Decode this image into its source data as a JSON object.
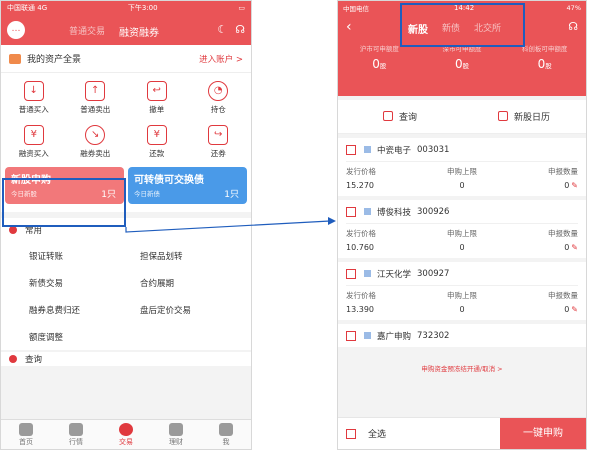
{
  "left": {
    "status": {
      "carrier": "中国联通",
      "network": "4G",
      "time": "下午3:00"
    },
    "nav": {
      "tabs": [
        "普通交易",
        "融资融券"
      ]
    },
    "asset": {
      "title": "我的资产全景",
      "enter": "进入账户 >"
    },
    "grid": [
      {
        "label": "普通买入",
        "icon": "cart-in-icon"
      },
      {
        "label": "普通卖出",
        "icon": "cart-out-icon"
      },
      {
        "label": "撤单",
        "icon": "cancel-order-icon"
      },
      {
        "label": "持仓",
        "icon": "pie-icon"
      },
      {
        "label": "融资买入",
        "icon": "margin-buy-icon"
      },
      {
        "label": "融券卖出",
        "icon": "short-sell-icon"
      },
      {
        "label": "还款",
        "icon": "repay-icon"
      },
      {
        "label": "还券",
        "icon": "return-stock-icon"
      }
    ],
    "cards": [
      {
        "title": "新股申购",
        "sub": "今日新股",
        "count": "1只",
        "color": "#f2787a"
      },
      {
        "title": "可转债可交换债",
        "sub": "今日新债",
        "count": "1只",
        "color": "#4a9ae8"
      }
    ],
    "common": {
      "title": "常用",
      "items": [
        "银证转账",
        "担保品划转",
        "新债交易",
        "合约展期",
        "融券息费归还",
        "盘后定价交易",
        "额度调整"
      ]
    },
    "query": "查询",
    "tabbar": [
      "首页",
      "行情",
      "交易",
      "理财",
      "我"
    ]
  },
  "right": {
    "status": {
      "carrier": "中国电信",
      "time": "14:42",
      "battery": "47%"
    },
    "nav": {
      "tabs": [
        "新股",
        "新债",
        "北交所"
      ]
    },
    "quota": [
      {
        "label": "沪市可申额度",
        "value": "0",
        "unit": "股"
      },
      {
        "label": "深市可申额度",
        "value": "0",
        "unit": "股"
      },
      {
        "label": "科创板可申额度",
        "value": "0",
        "unit": "股"
      }
    ],
    "actions": [
      "查询",
      "新股日历"
    ],
    "headers": [
      "发行价格",
      "申购上限",
      "申报数量"
    ],
    "stocks": [
      {
        "name": "中瓷电子",
        "code": "003031",
        "price": "15.270",
        "limit": "0",
        "qty": "0"
      },
      {
        "name": "博俊科技",
        "code": "300926",
        "price": "10.760",
        "limit": "0",
        "qty": "0"
      },
      {
        "name": "江天化学",
        "code": "300927",
        "price": "13.390",
        "limit": "0",
        "qty": "0"
      },
      {
        "name": "嘉广申购",
        "code": "732302"
      }
    ],
    "notice": "申购资金预冻结开通/取消 >",
    "select_all": "全选",
    "apply": "一键申购"
  },
  "colors": {
    "brand": "#ea5457",
    "highlight": "#1f5dbd"
  }
}
